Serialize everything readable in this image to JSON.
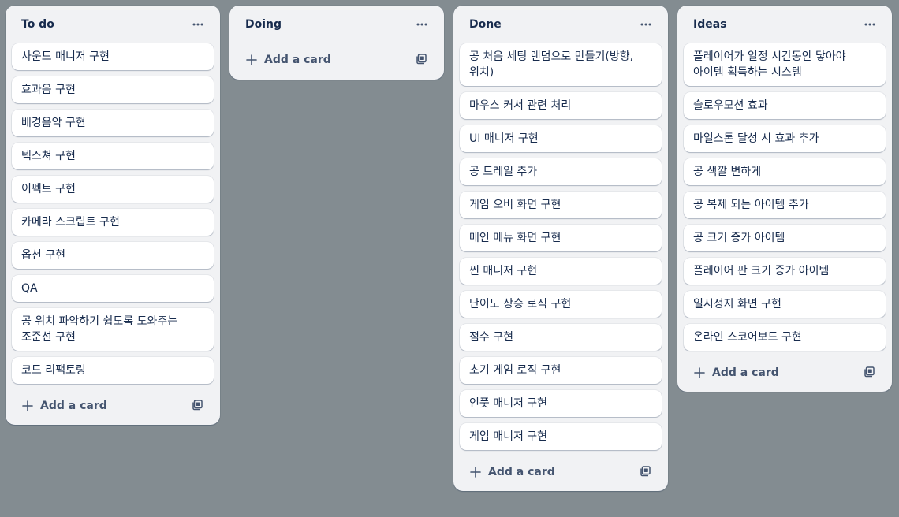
{
  "board": {
    "background": "#838c91",
    "lists": [
      {
        "id": "todo",
        "title": "To do",
        "cards": [
          "사운드 매니저 구현",
          "효과음 구현",
          "배경음악 구현",
          "텍스쳐 구현",
          "이펙트 구현",
          "카메라 스크립트 구현",
          "옵션 구현",
          "QA",
          "공 위치 파악하기 쉽도록 도와주는 조준선 구현",
          "코드 리팩토링"
        ],
        "add_card_label": "Add a card"
      },
      {
        "id": "doing",
        "title": "Doing",
        "cards": [],
        "add_card_label": "Add a card"
      },
      {
        "id": "done",
        "title": "Done",
        "cards": [
          "공 처음 세팅 랜덤으로 만들기(방향, 위치)",
          "마우스 커서 관련 처리",
          "UI 매니저 구현",
          "공 트레일 추가",
          "게임 오버 화면 구현",
          "메인 메뉴 화면 구현",
          "씬 매니저 구현",
          "난이도 상승 로직 구현",
          "점수 구현",
          "초기 게임 로직 구현",
          "인풋 매니저 구현",
          "게임 매니저 구현"
        ],
        "add_card_label": "Add a card"
      },
      {
        "id": "ideas",
        "title": "Ideas",
        "cards": [
          "플레이어가 일정 시간동안 닿아야 아이템 획득하는 시스템",
          "슬로우모션 효과",
          "마일스톤 달성 시 효과 추가",
          "공 색깔 변하게",
          "공 복제 되는 아이템 추가",
          "공 크기 증가 아이템",
          "플레이어 판 크기 증가 아이템",
          "일시정지 화면 구현",
          "온라인 스코어보드 구현"
        ],
        "add_card_label": "Add a card"
      }
    ]
  },
  "icons": {
    "list_menu": "ellipsis-icon",
    "add_card": "plus-icon",
    "template": "card-template-icon"
  },
  "colors": {
    "list_bg": "#f1f2f4",
    "card_bg": "#ffffff",
    "text": "#172b4d",
    "subtle_text": "#44546f"
  }
}
